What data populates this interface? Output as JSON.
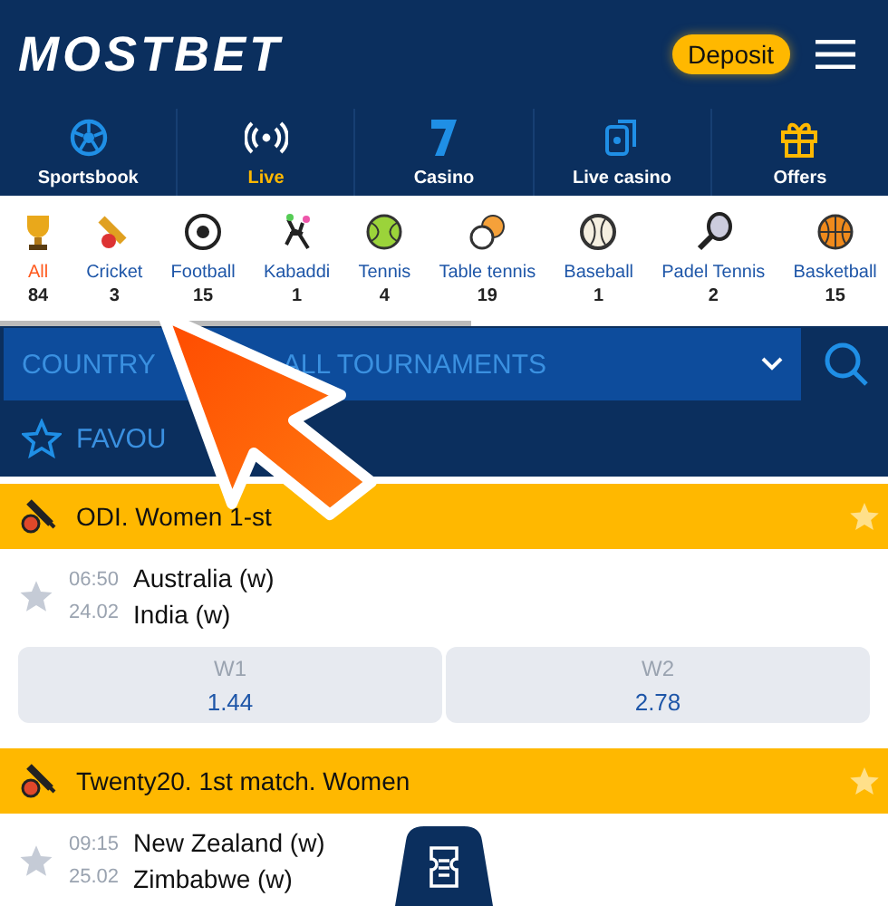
{
  "header": {
    "logo": "MOSTBET",
    "deposit_button": "Deposit"
  },
  "nav": [
    {
      "label": "Sportsbook",
      "selected": false
    },
    {
      "label": "Live",
      "selected": true
    },
    {
      "label": "Casino",
      "selected": false
    },
    {
      "label": "Live casino",
      "selected": false
    },
    {
      "label": "Offers",
      "selected": false
    }
  ],
  "sports": [
    {
      "label": "All",
      "count": "84",
      "selected": true
    },
    {
      "label": "Cricket",
      "count": "3",
      "selected": false
    },
    {
      "label": "Football",
      "count": "15",
      "selected": false
    },
    {
      "label": "Kabaddi",
      "count": "1",
      "selected": false
    },
    {
      "label": "Tennis",
      "count": "4",
      "selected": false
    },
    {
      "label": "Table tennis",
      "count": "19",
      "selected": false
    },
    {
      "label": "Baseball",
      "count": "1",
      "selected": false
    },
    {
      "label": "Padel Tennis",
      "count": "2",
      "selected": false
    },
    {
      "label": "Basketball",
      "count": "15",
      "selected": false
    }
  ],
  "filters": {
    "country": "COUNTRY",
    "tournaments": "ALL TOURNAMENTS"
  },
  "favourites": "FAVOU",
  "leagues": [
    {
      "title": "ODI. Women 1-st",
      "matches": [
        {
          "time": "06:50",
          "date": "24.02",
          "team1": "Australia (w)",
          "team2": "India (w)",
          "odds": [
            {
              "label": "W1",
              "value": "1.44"
            },
            {
              "label": "W2",
              "value": "2.78"
            }
          ]
        }
      ]
    },
    {
      "title": "Twenty20. 1st match. Women",
      "matches": [
        {
          "time": "09:15",
          "date": "25.02",
          "team1": "New Zealand (w)",
          "team2": "Zimbabwe (w)"
        }
      ]
    }
  ]
}
